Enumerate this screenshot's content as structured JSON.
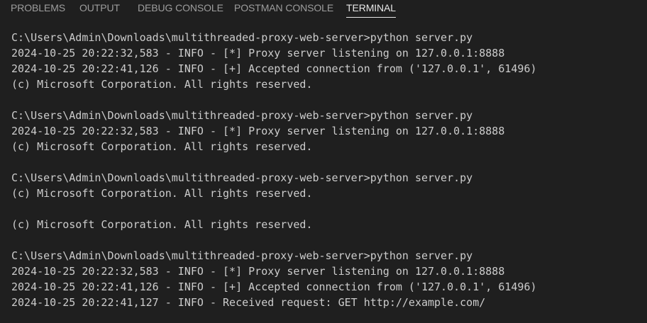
{
  "tabs": [
    {
      "label": "PROBLEMS",
      "active": false
    },
    {
      "label": "OUTPUT",
      "active": false
    },
    {
      "label": "DEBUG CONSOLE",
      "active": false
    },
    {
      "label": "POSTMAN CONSOLE",
      "active": false
    },
    {
      "label": "TERMINAL",
      "active": true
    }
  ],
  "terminal": {
    "lines": [
      "C:\\Users\\Admin\\Downloads\\multithreaded-proxy-web-server>python server.py",
      "2024-10-25 20:22:32,583 - INFO - [*] Proxy server listening on 127.0.0.1:8888",
      "2024-10-25 20:22:41,126 - INFO - [+] Accepted connection from ('127.0.0.1', 61496)",
      "(c) Microsoft Corporation. All rights reserved.",
      "",
      "C:\\Users\\Admin\\Downloads\\multithreaded-proxy-web-server>python server.py",
      "2024-10-25 20:22:32,583 - INFO - [*] Proxy server listening on 127.0.0.1:8888",
      "(c) Microsoft Corporation. All rights reserved.",
      "",
      "C:\\Users\\Admin\\Downloads\\multithreaded-proxy-web-server>python server.py",
      "(c) Microsoft Corporation. All rights reserved.",
      "",
      "(c) Microsoft Corporation. All rights reserved.",
      "",
      "C:\\Users\\Admin\\Downloads\\multithreaded-proxy-web-server>python server.py",
      "2024-10-25 20:22:32,583 - INFO - [*] Proxy server listening on 127.0.0.1:8888",
      "2024-10-25 20:22:41,126 - INFO - [+] Accepted connection from ('127.0.0.1', 61496)",
      "2024-10-25 20:22:41,127 - INFO - Received request: GET http://example.com/"
    ]
  }
}
